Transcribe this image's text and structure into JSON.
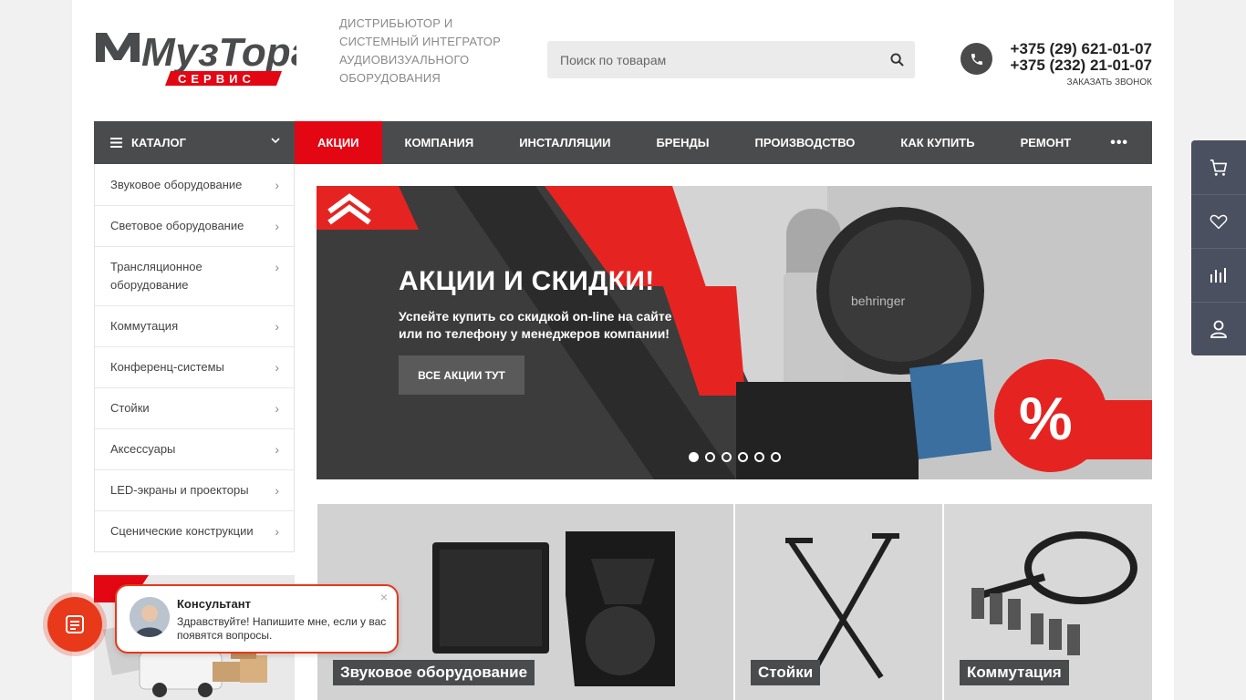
{
  "header": {
    "logo_text": "МузТорг",
    "logo_sub": "СЕРВИС",
    "tagline": [
      "ДИСТРИБЬЮТОР И",
      "СИСТЕМНЫЙ ИНТЕГРАТОР",
      "АУДИОВИЗУАЛЬНОГО",
      "ОБОРУДОВАНИЯ"
    ],
    "search_placeholder": "Поиск по товарам",
    "phones": [
      "+375 (29) 621-01-07",
      "+375 (232) 21-01-07"
    ],
    "callback_label": "ЗАКАЗАТЬ ЗВОНОК"
  },
  "nav": {
    "catalog_label": "КАТАЛОГ",
    "items": [
      "АКЦИИ",
      "КОМПАНИЯ",
      "ИНСТАЛЛЯЦИИ",
      "БРЕНДЫ",
      "ПРОИЗВОДСТВО",
      "КАК КУПИТЬ",
      "РЕМОНТ"
    ],
    "more_label": "•••"
  },
  "sidebar": {
    "items": [
      {
        "label": "Звуковое оборудование"
      },
      {
        "label": "Световое оборудование"
      },
      {
        "label": "Трансляционное оборудование"
      },
      {
        "label": "Коммутация"
      },
      {
        "label": "Конференц-системы"
      },
      {
        "label": "Стойки"
      },
      {
        "label": "Аксессуары"
      },
      {
        "label": "LED-экраны и проекторы"
      },
      {
        "label": "Сценические конструкции"
      }
    ]
  },
  "banner": {
    "title": "АКЦИИ И СКИДКИ!",
    "text": [
      "Успейте купить со скидкой on-line на сайте",
      "или по телефону у менеджеров компании!"
    ],
    "button_label": "ВСЕ АКЦИИ ТУТ",
    "percent_badge": "%",
    "brand_text": "behringer",
    "slides_total": 6,
    "active_slide": 1
  },
  "categories": [
    {
      "label": "Звуковое оборудование"
    },
    {
      "label": "Стойки"
    },
    {
      "label": "Коммутация"
    }
  ],
  "chat": {
    "name": "Консультант",
    "message": "Здравствуйте! Напишите мне, если у вас появятся вопросы.",
    "close": "×"
  },
  "colors": {
    "accent": "#e30613",
    "nav_bg": "#4a4b4d",
    "toolbar_bg": "#4a5060",
    "chat_accent": "#e8391b"
  },
  "icons": {
    "search": "search-icon",
    "phone": "phone-icon",
    "cart": "cart-icon",
    "favorites": "heart-icon",
    "compare": "bar-chart-icon",
    "account": "user-icon",
    "chat": "chat-icon"
  }
}
